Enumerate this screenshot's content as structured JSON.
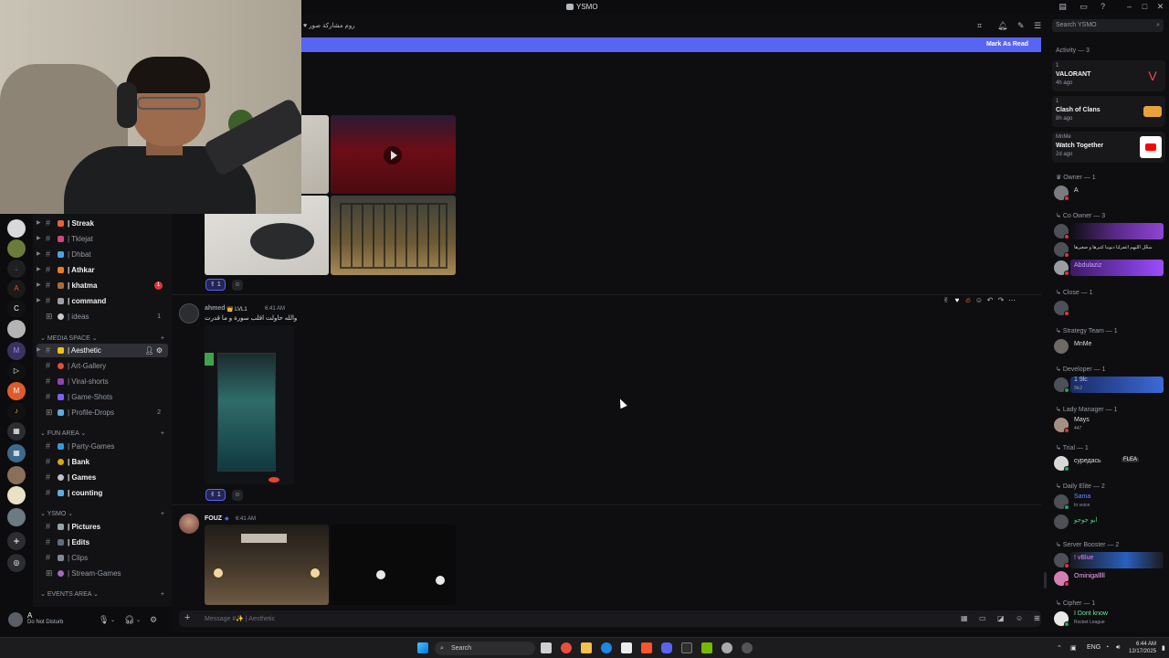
{
  "window": {
    "title": "YSMO",
    "search_placeholder": "Search YSMO"
  },
  "chat": {
    "mark_as_read": "Mark As Read",
    "composer_placeholder": "Message #✨ | Aesthetic",
    "messages": [
      {
        "reaction_count": "1"
      },
      {
        "username": "ahmed",
        "role_tag": "LVL1",
        "timestamp": "6:41 AM",
        "text": "والله حاولت اقلب سورة و ما قدرت",
        "reaction_count": "1"
      },
      {
        "username": "FOUZ",
        "timestamp": "6:41 AM"
      }
    ]
  },
  "channels": [
    {
      "label": "| Streak",
      "bold": true,
      "emoji_color": "#e8613c"
    },
    {
      "label": "| Tklejat",
      "bold": false,
      "emoji_color": "#c94b7b"
    },
    {
      "label": "| Dhbat",
      "bold": false,
      "emoji_color": "#4aa3df"
    },
    {
      "label": "| Athkar",
      "bold": true,
      "emoji_color": "#e67e22"
    },
    {
      "label": "| khatma",
      "bold": true,
      "emoji_color": "#a86c3c",
      "badge": "1"
    },
    {
      "label": "| command",
      "bold": true,
      "emoji_color": "#9aa0a6"
    },
    {
      "label": "| ideas",
      "bold": false,
      "emoji_color": "#c9c9c9",
      "count": "1"
    }
  ],
  "media_category": "MEDIA SPACE",
  "media_channels": [
    {
      "label": "| Aesthetic",
      "active": true,
      "emoji_color": "#f1c40f"
    },
    {
      "label": "| Art-Gallery",
      "bold": false,
      "emoji_color": "#e74c3c"
    },
    {
      "label": "| Viral-shorts",
      "bold": false,
      "emoji_color": "#8e44ad"
    },
    {
      "label": "| Game-Shots",
      "bold": false,
      "emoji_color": "#7d5fff"
    },
    {
      "label": "| Profile-Drops",
      "bold": false,
      "emoji_color": "#5dade2",
      "count": "2"
    }
  ],
  "fun_category": "FUN AREA",
  "fun_channels": [
    {
      "label": "| Party-Games",
      "bold": false,
      "emoji_color": "#3498db"
    },
    {
      "label": "| Bank",
      "bold": true,
      "emoji_color": "#d4ac0d"
    },
    {
      "label": "| Games",
      "bold": true,
      "emoji_color": "#bdc3c7"
    },
    {
      "label": "| counting",
      "bold": true,
      "emoji_color": "#5dade2"
    }
  ],
  "ysmo_category": "YSMO",
  "ysmo_channels": [
    {
      "label": "| Pictures",
      "bold": true,
      "emoji_color": "#95a5a6"
    },
    {
      "label": "| Edits",
      "bold": true,
      "emoji_color": "#5d6d7e"
    },
    {
      "label": "| Clips",
      "bold": false,
      "emoji_color": "#7f8c8d"
    },
    {
      "label": "| Stream-Games",
      "bold": false,
      "emoji_color": "#a569bd"
    }
  ],
  "events_category": "EVENTS AREA",
  "user": {
    "name": "A",
    "status": "Do Not Disturb"
  },
  "members": {
    "activity_header": "Activity — 3",
    "activities": [
      {
        "small": "1",
        "name": "VALORANT",
        "time": "4h ago",
        "icon_color": "#ff4655"
      },
      {
        "small": "1",
        "name": "Clash of Clans",
        "time": "8h ago",
        "icon_color": "#e8a33b"
      },
      {
        "small": "MnMe",
        "name": "Watch Together",
        "time": "2d ago",
        "icon_color": "#ff0000"
      }
    ],
    "groups": [
      {
        "header": "Owner — 1",
        "members": [
          {
            "name": "A"
          }
        ]
      },
      {
        "header": "Co Owner — 3",
        "members": [
          {
            "name": ""
          },
          {
            "name": "سجِّل الليهم اغفرلنا ذنوبنا كثيرها و صغيرها"
          },
          {
            "name": "Abdulaziz"
          }
        ]
      },
      {
        "header": "Close — 1",
        "members": [
          {
            "name": ""
          }
        ]
      },
      {
        "header": "Strategy Team — 1",
        "members": [
          {
            "name": "MnMe"
          }
        ]
      },
      {
        "header": "Developer — 1",
        "members": [
          {
            "name": "1 9lc",
            "sub": "9lc2"
          }
        ]
      },
      {
        "header": "Lady Manager — 1",
        "members": [
          {
            "name": "Mays",
            "sub": "447"
          }
        ]
      },
      {
        "header": "Trial — 1",
        "members": [
          {
            "name": "суредась",
            "tag": "FLEA"
          }
        ]
      },
      {
        "header": "Daily Elite — 2",
        "members": [
          {
            "name": "Sama",
            "sub": "In voice"
          },
          {
            "name": "ابو جوجو"
          }
        ]
      },
      {
        "header": "Server Booster — 2",
        "members": [
          {
            "name": "! vBlue",
            "sub": ""
          },
          {
            "name": "Ominigalllll"
          }
        ]
      },
      {
        "header": "Cipher — 1",
        "members": [
          {
            "name": "I Dont know",
            "sub": "Rocket League"
          }
        ]
      }
    ]
  },
  "taskbar": {
    "search_label": "Search",
    "lang": "ENG",
    "time": "6:44 AM",
    "date": "12/17/2025"
  }
}
